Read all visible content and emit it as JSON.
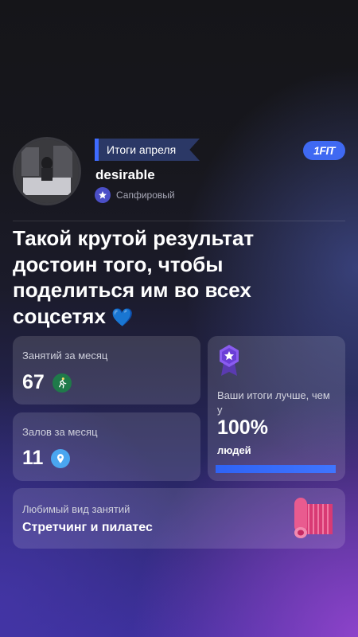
{
  "header": {
    "period_tag": "Итоги апреля",
    "brand": "1FIT",
    "username": "desirable",
    "tier": "Сапфировый"
  },
  "headline": {
    "text": "Такой крутой результат достоин того, чтобы поделиться им во всех соцсетях",
    "emoji": "💙"
  },
  "stats": {
    "sessions": {
      "label": "Занятий за месяц",
      "value": "67",
      "icon": "running-person-icon"
    },
    "gyms": {
      "label": "Залов за месяц",
      "value": "11",
      "icon": "location-pin-icon"
    }
  },
  "comparison": {
    "label": "Ваши итоги лучше, чем у",
    "value": "100%",
    "unit": "людей",
    "progress_percent": 100,
    "icon": "medal-star-icon"
  },
  "favorite": {
    "label": "Любимый вид занятий",
    "value": "Стретчинг и пилатес",
    "icon": "yoga-mat-icon"
  },
  "colors": {
    "accent_blue": "#3e6bff",
    "brand_badge": "#3f69f2",
    "mat_pink": "#e0417e",
    "medal_purple": "#7b4fd6"
  }
}
